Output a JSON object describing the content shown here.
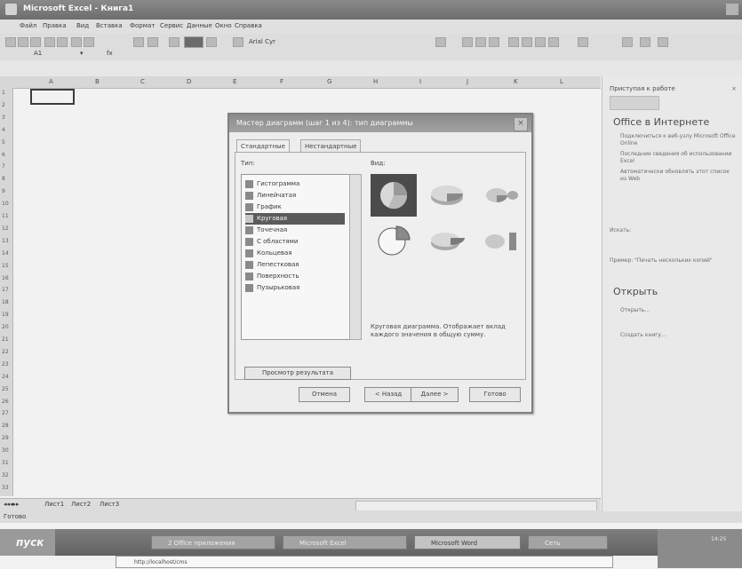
{
  "window": {
    "title": "Microsoft Excel - Книга1"
  },
  "menu": {
    "items": [
      "Файл",
      "Правка",
      "Вид",
      "Вставка",
      "Формат",
      "Сервис",
      "Данные",
      "Окно",
      "Справка"
    ]
  },
  "toolbar": {
    "name_box": "A1",
    "font_name": "Arial Cyr",
    "fx_label": "fx"
  },
  "sheet": {
    "columns": [
      "A",
      "B",
      "C",
      "D",
      "E",
      "F",
      "G",
      "H",
      "I",
      "J",
      "K",
      "L"
    ],
    "rows": [
      "1",
      "2",
      "3",
      "4",
      "5",
      "6",
      "7",
      "8",
      "9",
      "10",
      "11",
      "12",
      "13",
      "14",
      "15",
      "16",
      "17",
      "18",
      "19",
      "20",
      "21",
      "22",
      "23",
      "24",
      "25",
      "26",
      "27",
      "28",
      "29",
      "30",
      "31",
      "32",
      "33"
    ],
    "tabs": [
      "Лист1",
      "Лист2",
      "Лист3"
    ],
    "status": "Готово"
  },
  "taskpane": {
    "header": "Приступая к работе",
    "office_online": "Office в Интернете",
    "bullets": [
      "Подключиться к веб-узлу Microsoft Office Online",
      "Последние сведения об использовании Excel",
      "Автоматически обновлять этот список из Web"
    ],
    "more": "Искать:",
    "example": "Пример: \"Печать нескольких копий\"",
    "open_header": "Открыть",
    "open_items": [
      "Открыть...",
      "Создать книгу..."
    ]
  },
  "dialog": {
    "title": "Мастер диаграмм (шаг 1 из 4): тип диаграммы",
    "tabs": [
      "Стандартные",
      "Нестандартные"
    ],
    "type_label": "Тип:",
    "view_label": "Вид:",
    "types": [
      "Гистограмма",
      "Линейчатая",
      "График",
      "Круговая",
      "Точечная",
      "С областями",
      "Кольцевая",
      "Лепестковая",
      "Поверхность",
      "Пузырьковая"
    ],
    "selected_type_index": 3,
    "description": "Круговая диаграмма. Отображает вклад каждого значения в общую сумму.",
    "preview_button": "Просмотр результата",
    "buttons": {
      "cancel": "Отмена",
      "back": "< Назад",
      "next": "Далее >",
      "finish": "Готово"
    }
  },
  "taskbar": {
    "start": "пуск",
    "items": [
      "2 Office приложения",
      "Microsoft Excel",
      "Microsoft Word",
      "Сеть"
    ],
    "address": "http://localhost/cms",
    "clock": "14:25"
  }
}
